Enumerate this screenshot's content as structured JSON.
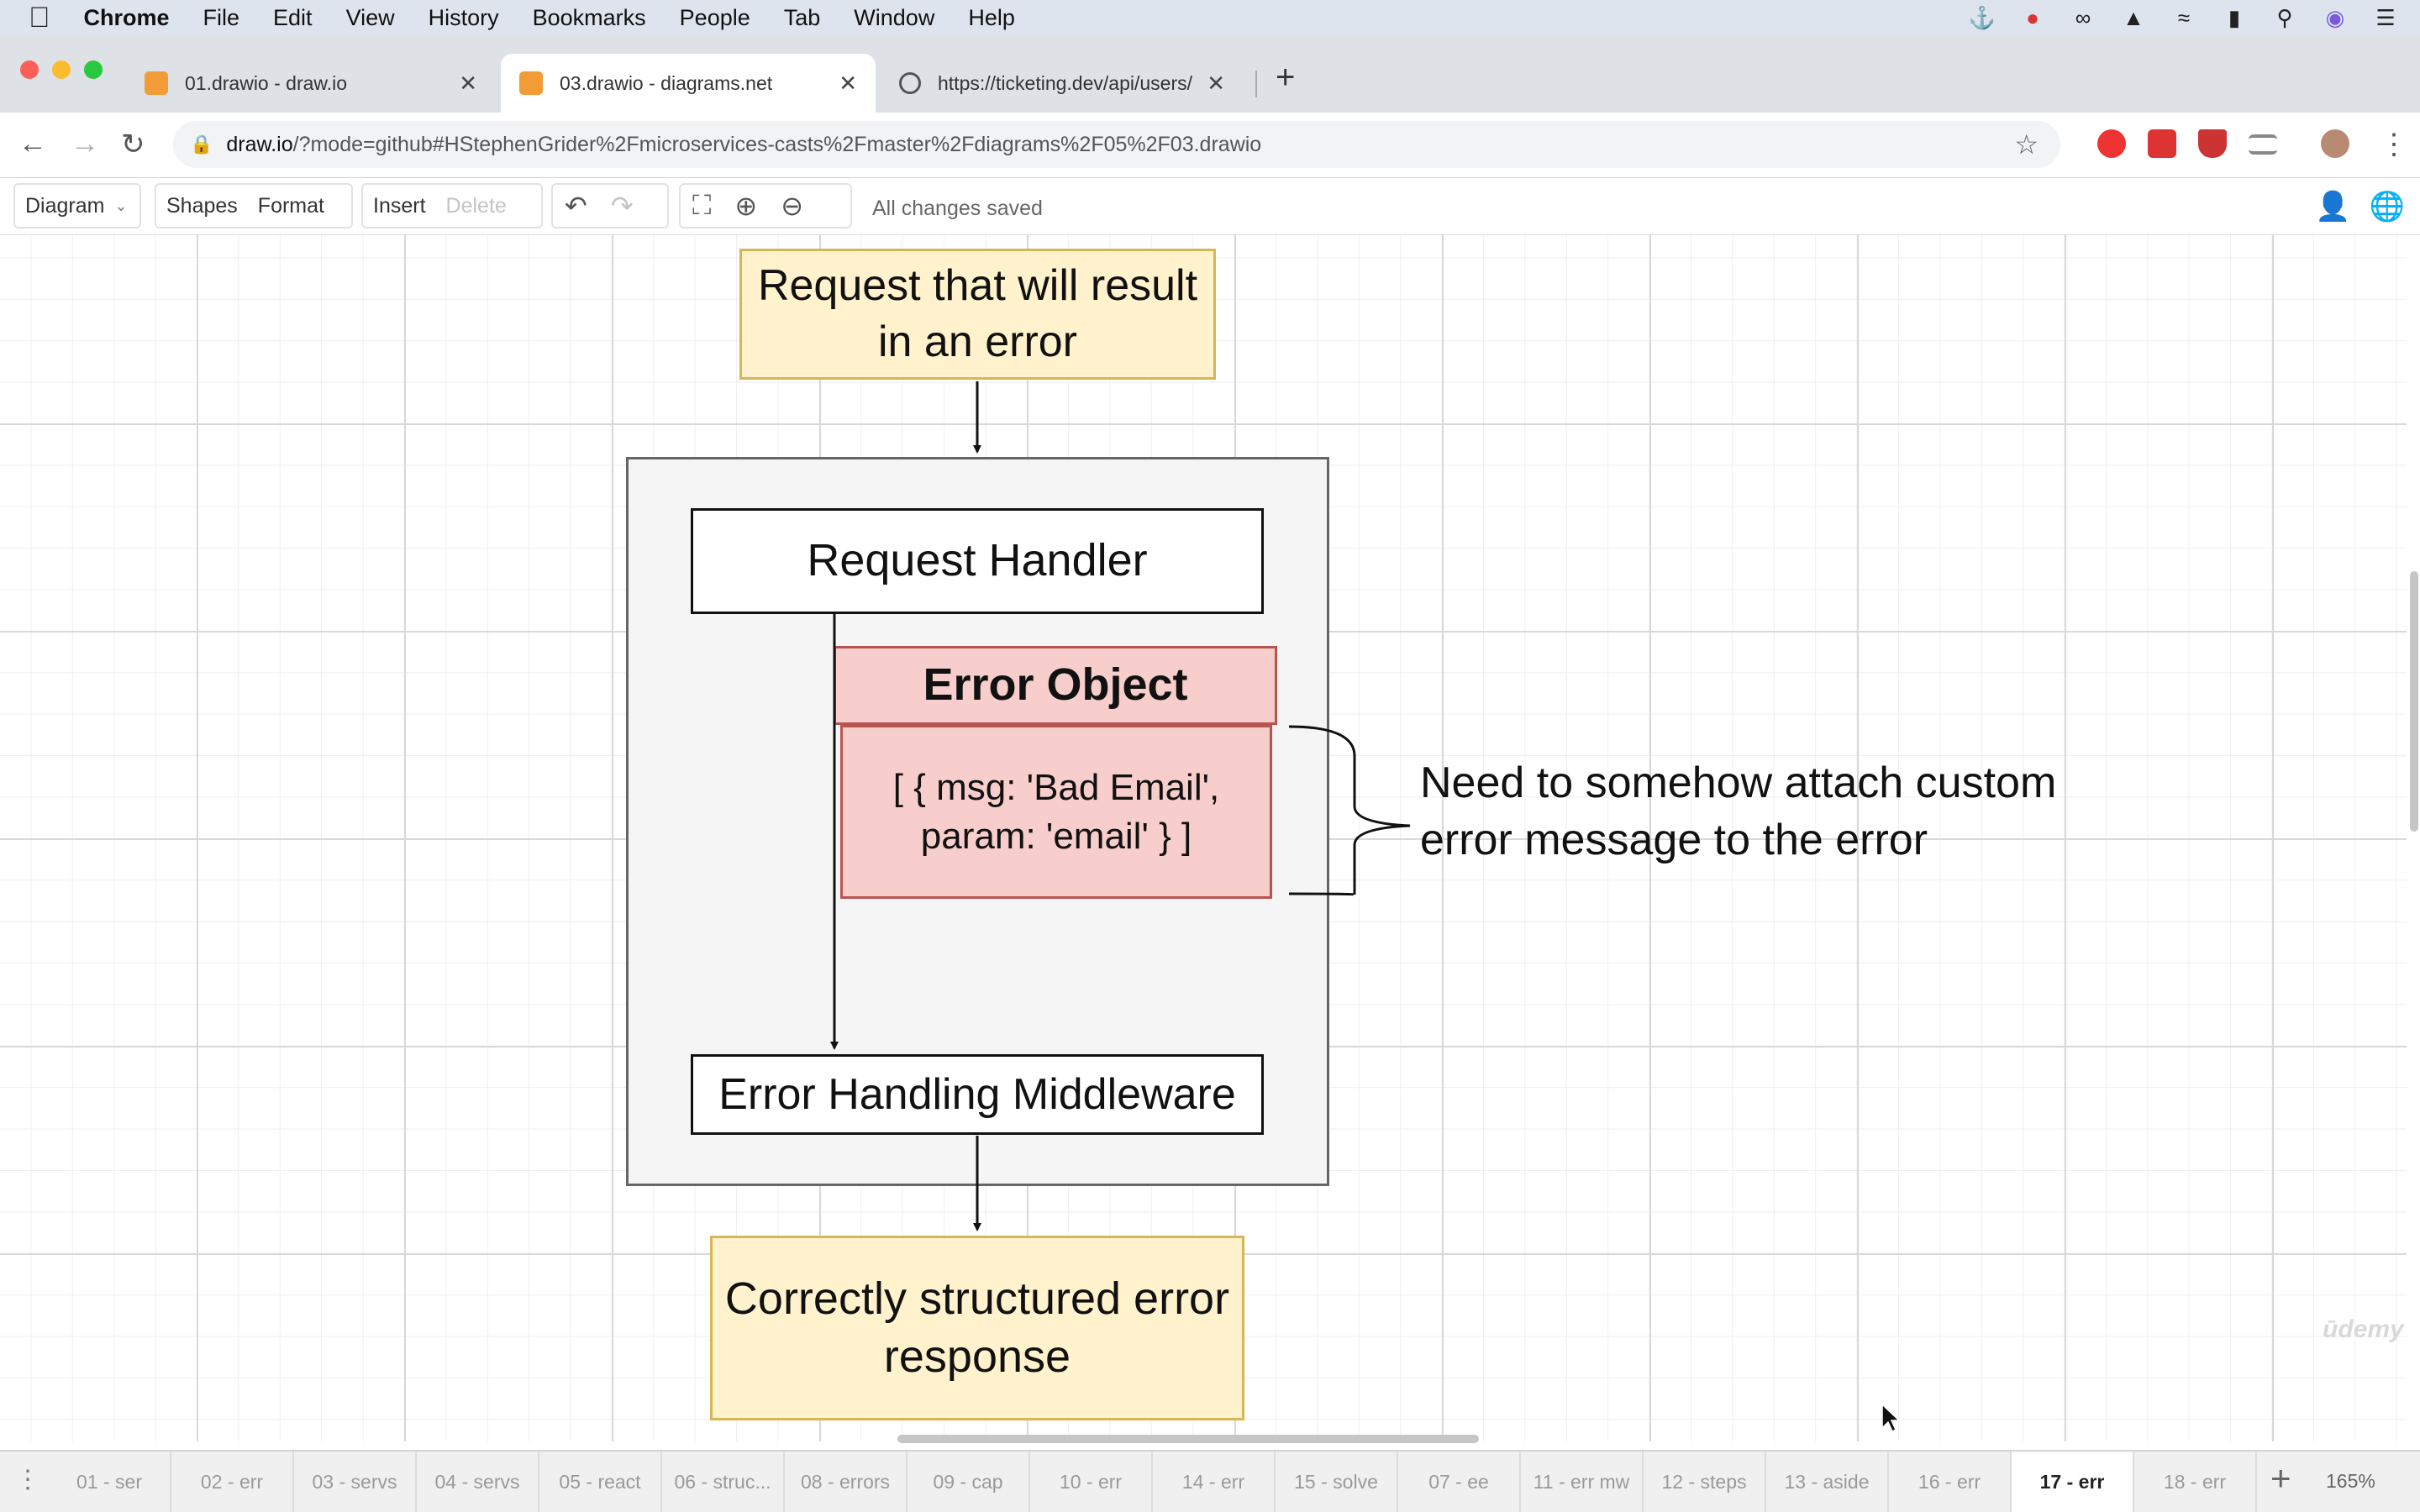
{
  "menubar": {
    "app_name": "Chrome",
    "items": [
      "File",
      "Edit",
      "View",
      "History",
      "Bookmarks",
      "People",
      "Tab",
      "Window",
      "Help"
    ],
    "status_icons": [
      "docker-icon",
      "app-icon",
      "glasses-icon",
      "gauge-icon",
      "wifi-icon",
      "battery-icon",
      "spotlight-icon",
      "siri-icon",
      "list-icon"
    ]
  },
  "browser": {
    "tabs": [
      {
        "title": "01.drawio - draw.io",
        "active": false
      },
      {
        "title": "03.drawio - diagrams.net",
        "active": true
      },
      {
        "title": "https://ticketing.dev/api/users/cu",
        "active": false
      }
    ],
    "url_host": "draw.io",
    "url_path": "/?mode=github#HStephenGrider%2Fmicroservices-casts%2Fmaster%2Fdiagrams%2F05%2F03.drawio"
  },
  "toolbar": {
    "diagram_label": "Diagram",
    "shapes_label": "Shapes",
    "format_label": "Format",
    "insert_label": "Insert",
    "delete_label": "Delete",
    "status": "All changes saved"
  },
  "diagram": {
    "request": "Request that will result in an error",
    "handler": "Request Handler",
    "error_object_title": "Error Object",
    "error_object_body": "[ { msg: 'Bad Email', param: 'email' } ]",
    "middleware": "Error Handling Middleware",
    "response": "Correctly structured error response",
    "note": "Need to somehow attach custom error message to the error"
  },
  "page_tabs": [
    "01 - ser",
    "02 - err",
    "03 - servs",
    "04 - servs",
    "05 - react",
    "06 - struc...",
    "08 - errors",
    "09 - cap",
    "10 - err",
    "14 - err",
    "15 - solve",
    "07 - ee",
    "11 - err mw",
    "12 - steps",
    "13 - aside",
    "16 - err",
    "17 - err",
    "18 - err"
  ],
  "active_page": "17 - err",
  "zoom": "165%",
  "watermark": "ūdemy",
  "colors": {
    "yellow_fill": "#fff2cc",
    "yellow_stroke": "#d6b656",
    "red_fill": "#f8cecc",
    "red_stroke": "#b85450",
    "container_fill": "#f5f5f5"
  }
}
